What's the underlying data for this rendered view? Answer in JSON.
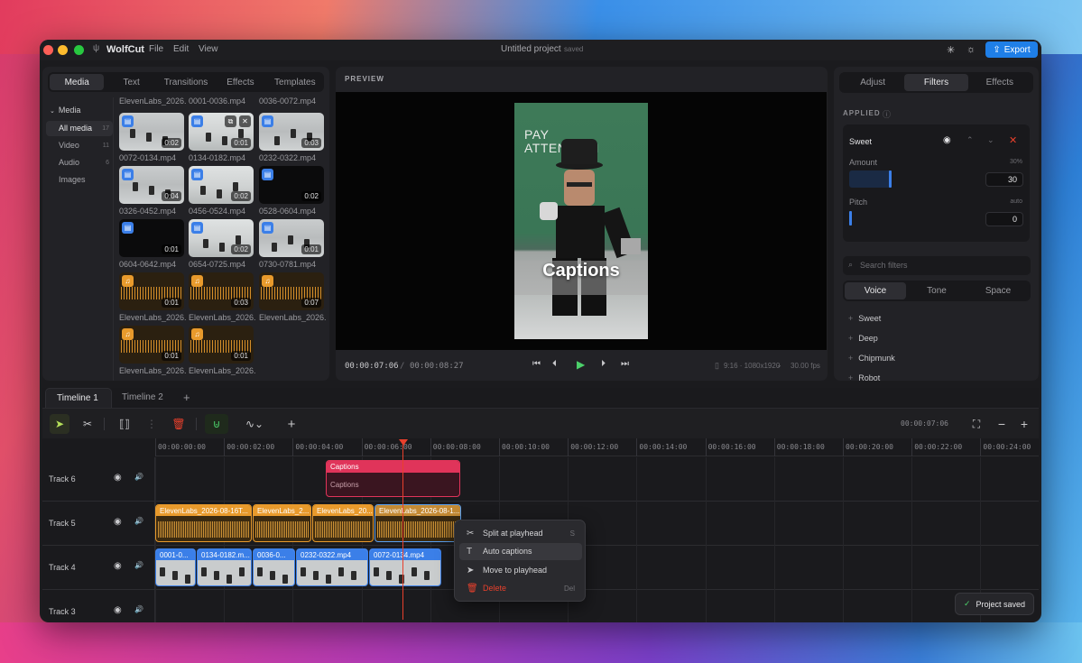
{
  "app": {
    "name": "WolfCut",
    "menus": [
      "File",
      "Edit",
      "View"
    ],
    "project_title": "Untitled project",
    "save_state": "saved",
    "export_label": "Export"
  },
  "media_panel": {
    "tabs": [
      "Media",
      "Text",
      "Transitions",
      "Effects",
      "Templates"
    ],
    "active_tab": "Media",
    "sidebar": {
      "group": "Media",
      "items": [
        {
          "label": "All media",
          "count": "17"
        },
        {
          "label": "Video",
          "count": "11"
        },
        {
          "label": "Audio",
          "count": "6"
        },
        {
          "label": "Images",
          "count": ""
        }
      ]
    },
    "top_labels": [
      "ElevenLabs_2026...",
      "0001-0036.mp4",
      "0036-0072.mp4"
    ],
    "items": [
      {
        "name": "0072-0134.mp4",
        "duration": "0:02",
        "kind": "video"
      },
      {
        "name": "0134-0182.mp4",
        "duration": "0:01",
        "kind": "video"
      },
      {
        "name": "0232-0322.mp4",
        "duration": "0:03",
        "kind": "video"
      },
      {
        "name": "0326-0452.mp4",
        "duration": "0:04",
        "kind": "video"
      },
      {
        "name": "0456-0524.mp4",
        "duration": "0:02",
        "kind": "video"
      },
      {
        "name": "0528-0604.mp4",
        "duration": "0:02",
        "kind": "video"
      },
      {
        "name": "0604-0642.mp4",
        "duration": "0:01",
        "kind": "video"
      },
      {
        "name": "0654-0725.mp4",
        "duration": "0:02",
        "kind": "video"
      },
      {
        "name": "0730-0781.mp4",
        "duration": "0:01",
        "kind": "video"
      },
      {
        "name": "ElevenLabs_2026...",
        "duration": "0:01",
        "kind": "audio"
      },
      {
        "name": "ElevenLabs_2026...",
        "duration": "0:03",
        "kind": "audio"
      },
      {
        "name": "ElevenLabs_2026...",
        "duration": "0:07",
        "kind": "audio"
      },
      {
        "name": "ElevenLabs_2026...",
        "duration": "0:01",
        "kind": "audio"
      },
      {
        "name": "ElevenLabs_2026...",
        "duration": "0:01",
        "kind": "audio"
      }
    ]
  },
  "preview": {
    "header": "PREVIEW",
    "overlay_sign": "PAY\nATTENTION",
    "caption_text": "Captions",
    "current_time": "00:00:07:06",
    "separator": "/",
    "total_time": "00:00:08:27",
    "aspect": "9:16 · 1080x1920",
    "fps": "30.00 fps"
  },
  "inspector": {
    "tabs": [
      "Adjust",
      "Filters",
      "Effects"
    ],
    "active_tab": "Filters",
    "applied_label": "APPLIED",
    "applied_filter": {
      "name": "Sweet",
      "amount_label": "Amount",
      "amount_pct": "30%",
      "amount_value": "30",
      "amount_fraction": 0.3,
      "pitch_label": "Pitch",
      "pitch_mode": "auto",
      "pitch_value": "0",
      "pitch_fraction": 0.0
    },
    "search_placeholder": "Search filters",
    "categories": [
      "Voice",
      "Tone",
      "Space"
    ],
    "active_category": "Voice",
    "filters": [
      "Sweet",
      "Deep",
      "Chipmunk",
      "Robot"
    ]
  },
  "timeline": {
    "tabs": [
      "Timeline 1",
      "Timeline 2"
    ],
    "add_tab": "+",
    "timecode": "00:00:07:06",
    "ruler": [
      "00:00:00:00",
      "00:00:02:00",
      "00:00:04:00",
      "00:00:06:00",
      "00:00:08:00",
      "00:00:10:00",
      "00:00:12:00",
      "00:00:14:00",
      "00:00:16:00",
      "00:00:18:00",
      "00:00:20:00",
      "00:00:22:00",
      "00:00:24:00"
    ],
    "tracks": [
      {
        "name": "Track 6",
        "clips": [
          {
            "label": "Captions",
            "sub": "Captions",
            "type": "caption"
          }
        ]
      },
      {
        "name": "Track 5",
        "clips": [
          {
            "label": "ElevenLabs_2026-08-16T...",
            "type": "audio"
          },
          {
            "label": "ElevenLabs_2...",
            "type": "audio"
          },
          {
            "label": "ElevenLabs_20...",
            "type": "audio"
          },
          {
            "label": "ElevenLabs_2026-08-1...",
            "type": "audio",
            "selected": true
          }
        ]
      },
      {
        "name": "Track 4",
        "clips": [
          {
            "label": "0001-0...",
            "type": "video"
          },
          {
            "label": "0134-0182.m...",
            "type": "video"
          },
          {
            "label": "0036-0...",
            "type": "video"
          },
          {
            "label": "0232-0322.mp4",
            "type": "video"
          },
          {
            "label": "0072-0134.mp4",
            "type": "video"
          }
        ]
      },
      {
        "name": "Track 3",
        "clips": []
      }
    ]
  },
  "context_menu": [
    {
      "label": "Split at playhead",
      "shortcut": "S",
      "icon": "scissors-icon"
    },
    {
      "label": "Auto captions",
      "shortcut": "",
      "icon": "text-icon"
    },
    {
      "label": "Move to playhead",
      "shortcut": "",
      "icon": "cursor-icon"
    },
    {
      "label": "Delete",
      "shortcut": "Del",
      "icon": "trash-icon",
      "danger": true
    }
  ],
  "toast": {
    "text": "Project saved"
  },
  "colors": {
    "accent": "#1f7fe8",
    "caption": "#e0345a",
    "audio": "#e89a2c",
    "video": "#3b7fe8",
    "playhead": "#e8402c",
    "green": "#4cd06a"
  }
}
